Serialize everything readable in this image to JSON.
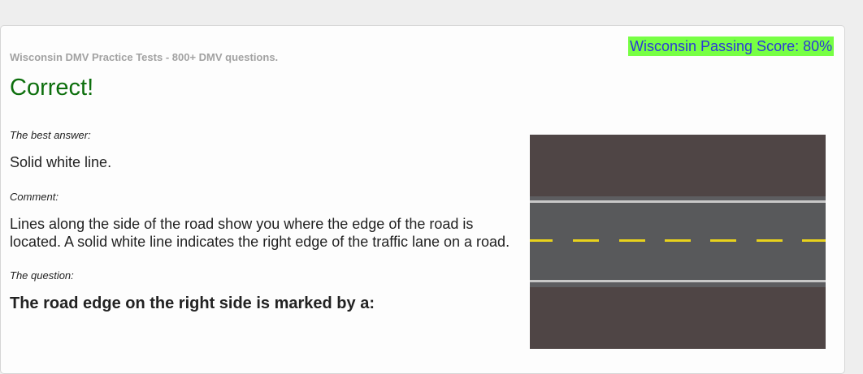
{
  "header": {
    "passing_score": "Wisconsin Passing Score: 80%",
    "site_title": "Wisconsin DMV Practice Tests - 800+ DMV questions."
  },
  "result": {
    "status": "Correct!"
  },
  "answer_section": {
    "best_answer_label": "The best answer:",
    "best_answer": "Solid white line.",
    "comment_label": "Comment:",
    "comment": "Lines along the side of the road show you where the edge of the road is located. A solid white line indicates the right edge of the traffic lane on a road.",
    "question_label": "The question:",
    "question": "The road edge on the right side is marked by a:"
  },
  "image": {
    "icon": "road-markings-image"
  },
  "colors": {
    "correct": "#0d6f0d",
    "passing_score_bg": "#77ff44",
    "passing_score_text": "#2b39d8",
    "site_title": "#a2a2a2"
  }
}
